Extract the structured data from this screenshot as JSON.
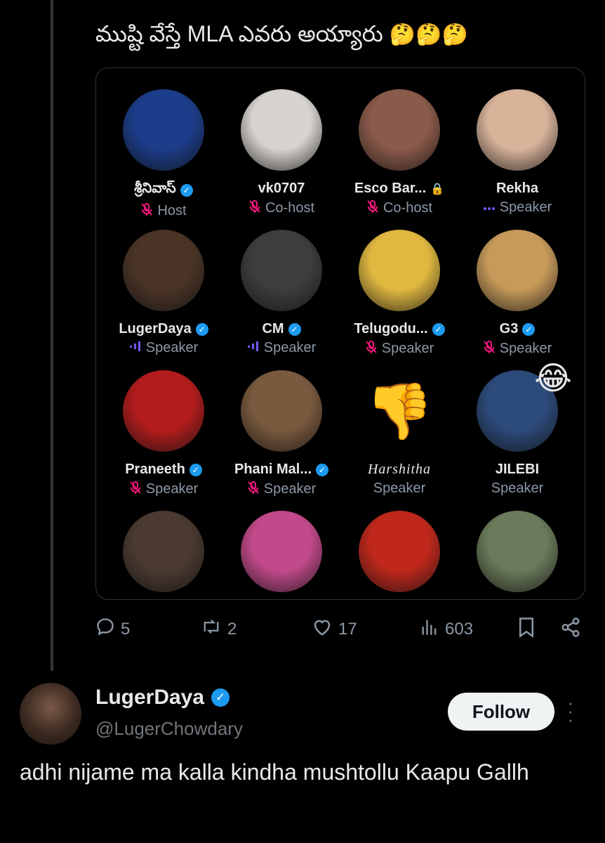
{
  "post": {
    "caption": "ముష్టి వేస్తే MLA ఎవరు అయ్యారు",
    "caption_emojis": "🤔🤔🤔"
  },
  "space": {
    "participants": [
      {
        "name": "శ్రీనివాస్",
        "role": "Host",
        "verified": true,
        "status": "muted",
        "avatar_color": "#1c3d8a"
      },
      {
        "name": "vk0707",
        "role": "Co-host",
        "verified": false,
        "status": "muted",
        "avatar_color": "#d7d3cf"
      },
      {
        "name": "Esco Bar...",
        "role": "Co-host",
        "verified": false,
        "status": "muted",
        "locked": true,
        "avatar_color": "#8a5a4a"
      },
      {
        "name": "Rekha",
        "role": "Speaker",
        "verified": false,
        "status": "idle",
        "avatar_color": "#d8b39a"
      },
      {
        "name": "LugerDaya",
        "role": "Speaker",
        "verified": true,
        "status": "speaking",
        "avatar_color": "#4a3426"
      },
      {
        "name": "CM",
        "role": "Speaker",
        "verified": true,
        "status": "speaking",
        "avatar_color": "#3d3d3d"
      },
      {
        "name": "Telugodu...",
        "role": "Speaker",
        "verified": true,
        "status": "muted",
        "avatar_color": "#e0b840"
      },
      {
        "name": "G3",
        "role": "Speaker",
        "verified": true,
        "status": "muted",
        "avatar_color": "#c79a5a"
      },
      {
        "name": "Praneeth",
        "role": "Speaker",
        "verified": true,
        "status": "muted",
        "avatar_color": "#b31c1c"
      },
      {
        "name": "Phani Mal...",
        "role": "Speaker",
        "verified": true,
        "status": "muted",
        "avatar_color": "#7a5a3e"
      },
      {
        "name": "Harshitha",
        "role": "Speaker",
        "verified": false,
        "status": "none",
        "avatar_color": "#000000",
        "italic": true
      },
      {
        "name": "JILEBI",
        "role": "Speaker",
        "verified": false,
        "status": "none",
        "avatar_color": "#2c4a7a"
      },
      {
        "name": "",
        "role": "",
        "verified": false,
        "status": "none",
        "avatar_color": "#4a3a30"
      },
      {
        "name": "",
        "role": "",
        "verified": false,
        "status": "none",
        "avatar_color": "#c24a8a"
      },
      {
        "name": "",
        "role": "",
        "verified": false,
        "status": "none",
        "avatar_color": "#c0281c"
      },
      {
        "name": "",
        "role": "",
        "verified": false,
        "status": "none",
        "avatar_color": "#6a7a5a"
      }
    ],
    "status_icons": {
      "muted": "mic-off-icon",
      "speaking": "speaking-icon",
      "idle": "dots-icon"
    },
    "thumbs_down_emoji": "👎",
    "laugh_emoji": "😂",
    "mute_icon": "🔇"
  },
  "actions": {
    "replies": "5",
    "reposts": "2",
    "likes": "17",
    "views": "603"
  },
  "reply": {
    "display_name": "LugerDaya",
    "handle": "@LugerChowdary",
    "follow_label": "Follow",
    "text": "adhi nijame ma kalla kindha mushtollu Kaapu Gallh"
  },
  "colors": {
    "background": "#000000",
    "verified": "#1d9bf0",
    "muted": "#f91880",
    "speaking": "#7856ff",
    "secondary_text": "#8b98a5"
  }
}
